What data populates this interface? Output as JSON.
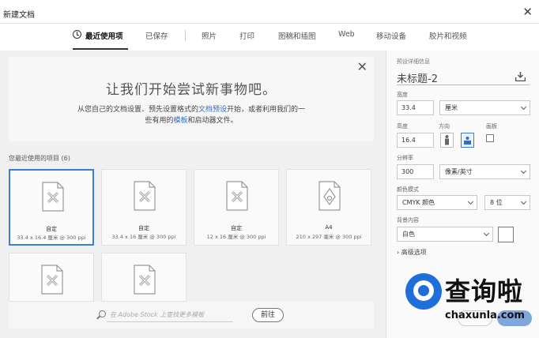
{
  "window": {
    "title": "新建文档",
    "close": "✕"
  },
  "tabs": [
    {
      "label": "最近使用项"
    },
    {
      "label": "已保存"
    },
    {
      "label": "照片"
    },
    {
      "label": "打印"
    },
    {
      "label": "图稿和插图"
    },
    {
      "label": "Web"
    },
    {
      "label": "移动设备"
    },
    {
      "label": "胶片和视频"
    }
  ],
  "banner": {
    "title": "让我们开始尝试新事物吧。",
    "line1_a": "从您自己的文档设置、预先设置格式的",
    "line1_link": "文档预设",
    "line1_b": "开始，或者利用我们的一",
    "line2_a": "些有用的",
    "line2_link": "模板",
    "line2_b": "和启动器文件。",
    "close": "✕"
  },
  "recent": {
    "label": "您最近使用的项目",
    "count": "(6)",
    "items": [
      {
        "name": "自定",
        "dims": "33.4 x 16.4 厘米 @ 300 ppi"
      },
      {
        "name": "自定",
        "dims": "33.4 x 16 厘米 @ 300 ppi"
      },
      {
        "name": "自定",
        "dims": "12 x 16 厘米 @ 300 ppi"
      },
      {
        "name": "A4",
        "dims": "210 x 297 毫米 @ 300 ppi"
      },
      {
        "name": "",
        "dims": ""
      },
      {
        "name": "",
        "dims": ""
      }
    ]
  },
  "search": {
    "placeholder": "在 Adobe Stock 上查找更多模板",
    "go_label": "前往"
  },
  "details": {
    "header": "预设详细信息",
    "doc_name": "未标题-2",
    "width_label": "宽度",
    "width_value": "33.4",
    "width_unit": "厘米",
    "height_label": "高度",
    "height_value": "16.4",
    "orientation_label": "方向",
    "artboard_label": "画板",
    "resolution_label": "分辨率",
    "resolution_value": "300",
    "resolution_unit": "像素/英寸",
    "color_mode_label": "颜色模式",
    "color_mode_value": "CMYK 颜色",
    "bit_depth_value": "8 位",
    "background_label": "背景内容",
    "background_value": "白色",
    "advanced_label": "高级选项"
  },
  "watermark": {
    "text": "查询啦",
    "url": "chaxunla.com"
  },
  "colors": {
    "accent": "#3c7ddc",
    "link": "#2d6fca"
  }
}
